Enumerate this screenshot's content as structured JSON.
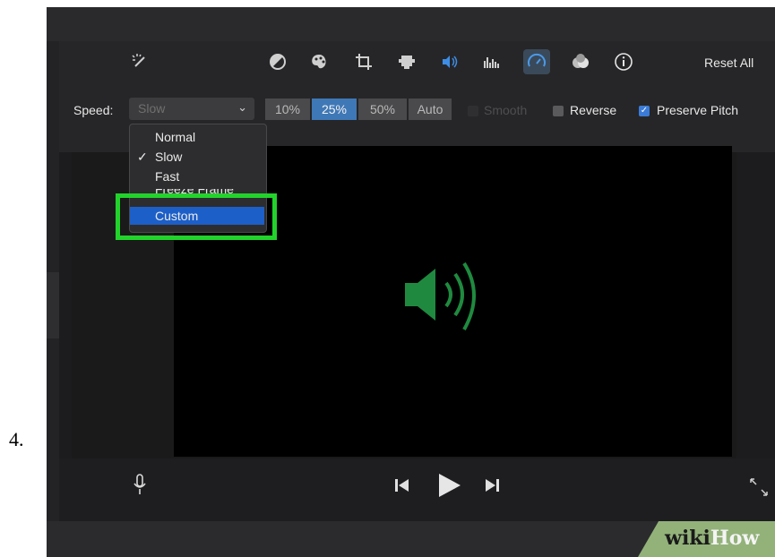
{
  "step_number": "4.",
  "toolbar": {
    "icons": [
      "magic-wand-icon",
      "color-balance-icon",
      "color-palette-icon",
      "crop-icon",
      "camera-icon",
      "volume-icon",
      "equalizer-icon",
      "speed-icon",
      "filter-icon",
      "info-icon"
    ],
    "reset_label": "Reset All"
  },
  "speed_row": {
    "label": "Speed:",
    "selected_value": "Slow",
    "segments": [
      "10%",
      "25%",
      "50%",
      "Auto"
    ],
    "active_segment": "25%",
    "smooth_label": "Smooth",
    "reverse_label": "Reverse",
    "preserve_pitch_label": "Preserve Pitch",
    "preserve_pitch_checked": true
  },
  "dropdown": {
    "items": [
      "Normal",
      "Slow",
      "Fast",
      "Freeze Frame",
      "Custom"
    ],
    "checked_item": "Slow",
    "highlighted_item": "Custom",
    "check_glyph": "✓"
  },
  "playback": {
    "icons": [
      "microphone-icon",
      "skip-back-icon",
      "play-icon",
      "skip-forward-icon",
      "fullscreen-icon"
    ]
  },
  "watermark": {
    "part1": "wiki",
    "part2": "How"
  },
  "colors": {
    "highlight": "#22d32b",
    "accent": "#1d5fc8",
    "speaker": "#1f8a3f"
  }
}
